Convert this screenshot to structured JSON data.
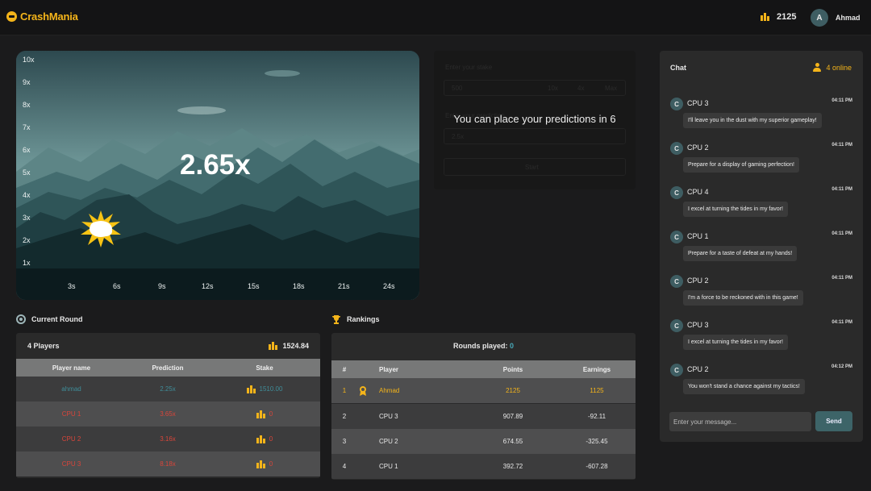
{
  "header": {
    "brand": "CrashMania",
    "coins": "2125",
    "avatar_letter": "A",
    "username": "Ahmad"
  },
  "game": {
    "multiplier": "2.65x",
    "y_ticks": [
      "10x",
      "9x",
      "8x",
      "7x",
      "6x",
      "5x",
      "4x",
      "3x",
      "2x",
      "1x"
    ],
    "x_ticks": [
      "3s",
      "6s",
      "9s",
      "12s",
      "15s",
      "18s",
      "21s",
      "24s"
    ]
  },
  "bet_panel": {
    "message": "You can place your predictions in 6",
    "stake_label": "Enter your stake",
    "stake_value": "500",
    "quick": [
      "10x",
      "4x",
      "Max"
    ],
    "prediction_label": "Enter your prediction",
    "prediction_value": "2.5x",
    "start_label": "Start"
  },
  "current_round": {
    "title": "Current Round",
    "players_count": "4 Players",
    "total": "1524.84",
    "columns": [
      "Player name",
      "Prediction",
      "Stake"
    ],
    "rows": [
      {
        "name": "ahmad",
        "prediction": "2.25x",
        "stake": "1510.00"
      },
      {
        "name": "CPU 1",
        "prediction": "3.65x",
        "stake": "0"
      },
      {
        "name": "CPU 2",
        "prediction": "3.16x",
        "stake": "0"
      },
      {
        "name": "CPU 3",
        "prediction": "8.18x",
        "stake": "0"
      }
    ]
  },
  "rankings": {
    "title": "Rankings",
    "rounds_label": "Rounds played:",
    "rounds_value": "0",
    "columns": [
      "#",
      "Player",
      "Points",
      "Earnings"
    ],
    "rows": [
      {
        "rank": "1",
        "player": "Ahmad",
        "points": "2125",
        "earnings": "1125"
      },
      {
        "rank": "2",
        "player": "CPU 3",
        "points": "907.89",
        "earnings": "-92.11"
      },
      {
        "rank": "3",
        "player": "CPU 2",
        "points": "674.55",
        "earnings": "-325.45"
      },
      {
        "rank": "4",
        "player": "CPU 1",
        "points": "392.72",
        "earnings": "-607.28"
      }
    ]
  },
  "chat": {
    "title": "Chat",
    "online": "4 online",
    "messages": [
      {
        "avatar": "C",
        "sender": "CPU 3",
        "time": "04:11 PM",
        "text": "I'll leave you in the dust with my superior gameplay!"
      },
      {
        "avatar": "C",
        "sender": "CPU 2",
        "time": "04:11 PM",
        "text": "Prepare for a display of gaming perfection!"
      },
      {
        "avatar": "C",
        "sender": "CPU 4",
        "time": "04:11 PM",
        "text": "I excel at turning the tides in my favor!"
      },
      {
        "avatar": "C",
        "sender": "CPU 1",
        "time": "04:11 PM",
        "text": "Prepare for a taste of defeat at my hands!"
      },
      {
        "avatar": "C",
        "sender": "CPU 2",
        "time": "04:11 PM",
        "text": "I'm a force to be reckoned with in this game!"
      },
      {
        "avatar": "C",
        "sender": "CPU 3",
        "time": "04:11 PM",
        "text": "I excel at turning the tides in my favor!"
      },
      {
        "avatar": "C",
        "sender": "CPU 2",
        "time": "04:12 PM",
        "text": "You won't stand a chance against my tactics!"
      }
    ],
    "input_placeholder": "Enter your message...",
    "send_label": "Send"
  },
  "colors": {
    "accent": "#f4b41a",
    "teal": "#3d6468",
    "cpu_red": "#d9453a",
    "player_teal": "#47a8b8"
  }
}
